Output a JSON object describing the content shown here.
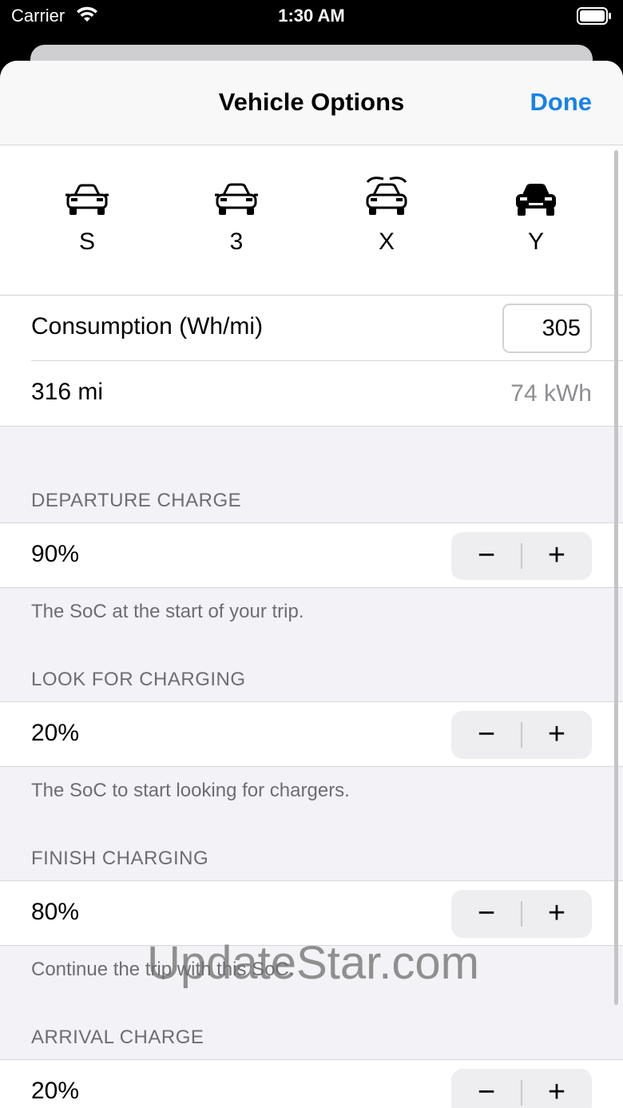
{
  "status_bar": {
    "carrier": "Carrier",
    "time": "1:30 AM",
    "wifi_icon": "wifi-icon",
    "battery_icon": "battery-icon"
  },
  "nav": {
    "title": "Vehicle Options",
    "done_label": "Done",
    "accent_color": "#1a82e2"
  },
  "models": [
    {
      "label": "S",
      "icon": "car-s-icon",
      "selected": false
    },
    {
      "label": "3",
      "icon": "car-3-icon",
      "selected": false
    },
    {
      "label": "X",
      "icon": "car-x-falcon-doors-icon",
      "selected": false
    },
    {
      "label": "Y",
      "icon": "car-y-icon",
      "selected": true
    }
  ],
  "consumption": {
    "label": "Consumption (Wh/mi)",
    "value": "305"
  },
  "range": {
    "distance": "316 mi",
    "capacity": "74 kWh"
  },
  "sections": [
    {
      "header": "DEPARTURE CHARGE",
      "value": "90%",
      "footer": "The SoC at the start of your trip."
    },
    {
      "header": "LOOK FOR CHARGING",
      "value": "20%",
      "footer": "The SoC to start looking for chargers."
    },
    {
      "header": "FINISH CHARGING",
      "value": "80%",
      "footer": "Continue the trip with this SoC."
    },
    {
      "header": "ARRIVAL CHARGE",
      "value": "20%",
      "footer": ""
    }
  ],
  "stepper": {
    "minus": "−",
    "plus": "+"
  },
  "watermark": "UpdateStar.com"
}
